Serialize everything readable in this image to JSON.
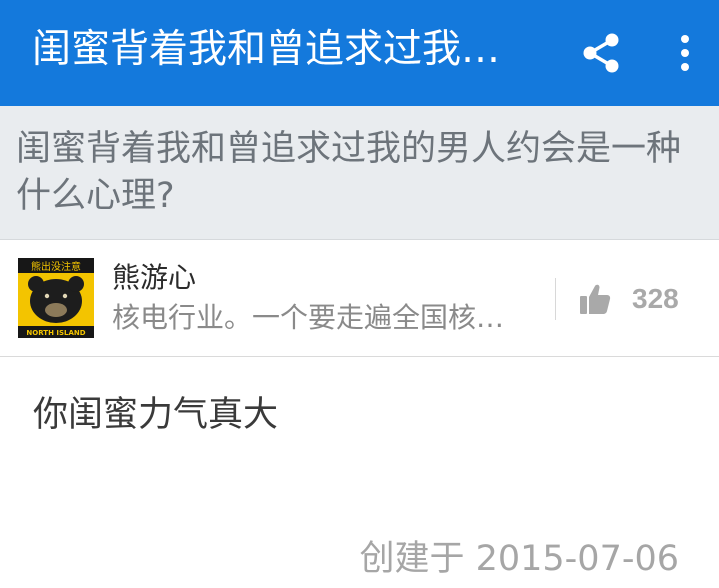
{
  "appbar": {
    "title": "闺蜜背着我和曾追求过我…",
    "share_icon": "share-icon",
    "more_icon": "more-vert-icon",
    "color": "#1479dc"
  },
  "question": {
    "title": "闺蜜背着我和曾追求过我的男人约会是一种什么心理?"
  },
  "answer": {
    "author": {
      "name": "熊游心",
      "bio": "核电行业。一个要走遍全国核…",
      "avatar": {
        "top_text": "熊出没注意",
        "bottom_text": "NORTH ISLAND"
      }
    },
    "votes": {
      "icon": "thumbs-up-icon",
      "count": "328"
    },
    "content": "你闺蜜力气真大",
    "created": "创建于 2015-07-06"
  }
}
